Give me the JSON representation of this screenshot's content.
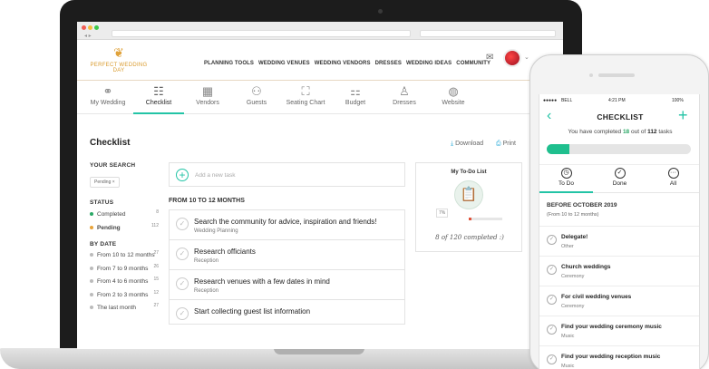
{
  "brand": {
    "name": "PERFECT WEDDING DAY",
    "color": "#d99a2b"
  },
  "accent": "#23c4a6",
  "header": {
    "nav": [
      "PLANNING TOOLS",
      "WEDDING VENUES",
      "WEDDING VENDORS",
      "DRESSES",
      "WEDDING IDEAS",
      "COMMUNITY"
    ]
  },
  "tabs": [
    {
      "label": "My Wedding",
      "icon": "rings-icon"
    },
    {
      "label": "Checklist",
      "icon": "clipboard-icon"
    },
    {
      "label": "Vendors",
      "icon": "store-icon"
    },
    {
      "label": "Guests",
      "icon": "people-icon"
    },
    {
      "label": "Seating Chart",
      "icon": "seating-icon"
    },
    {
      "label": "Budget",
      "icon": "budget-icon"
    },
    {
      "label": "Dresses",
      "icon": "dress-icon"
    },
    {
      "label": "Website",
      "icon": "globe-icon"
    }
  ],
  "page": {
    "title": "Checklist",
    "download": "Download",
    "print": "Print"
  },
  "sidebar": {
    "search_heading": "YOUR SEARCH",
    "search_chip": "Pending ×",
    "status_heading": "STATUS",
    "status": [
      {
        "label": "Completed",
        "count": "8",
        "color": "#2aa866"
      },
      {
        "label": "Pending",
        "count": "112",
        "color": "#e8a33a"
      }
    ],
    "date_heading": "BY DATE",
    "dates": [
      {
        "label": "From 10 to 12 months",
        "count": "27"
      },
      {
        "label": "From 7 to 9 months",
        "count": "26"
      },
      {
        "label": "From 4 to 6 months",
        "count": "15"
      },
      {
        "label": "From 2 to 3 months",
        "count": "12"
      },
      {
        "label": "The last month",
        "count": "27"
      }
    ]
  },
  "add_task_placeholder": "Add a new task",
  "section_title": "FROM 10 TO 12 MONTHS",
  "tasks": [
    {
      "title": "Search the community for advice, inspiration and friends!",
      "category": "Wedding Planning"
    },
    {
      "title": "Research officiants",
      "category": "Reception"
    },
    {
      "title": "Research venues with a few dates in mind",
      "category": "Reception"
    },
    {
      "title": "Start collecting guest list information",
      "category": ""
    }
  ],
  "todo_card": {
    "heading": "My To-Do List",
    "percent": "7%",
    "percent_value": 0.07,
    "completed_text": "8 of 120 completed :)"
  },
  "phone": {
    "carrier": "BELL",
    "time": "4:21 PM",
    "battery": "100%",
    "title": "CHECKLIST",
    "progress_prefix": "You have completed",
    "progress_done": "18",
    "progress_mid": "out of",
    "progress_total": "112",
    "progress_suffix": "tasks",
    "progress_value": 0.16,
    "tabs": [
      {
        "label": "To Do",
        "icon": "clock-icon"
      },
      {
        "label": "Done",
        "icon": "check-icon"
      },
      {
        "label": "All",
        "icon": "more-icon"
      }
    ],
    "group_heading": "BEFORE OCTOBER 2019",
    "group_sub": "(From 10 to 12 months)",
    "items": [
      {
        "title": "Delegate!",
        "category": "Other"
      },
      {
        "title": "Church weddings",
        "category": "Ceremony"
      },
      {
        "title": "For civil wedding venues",
        "category": "Ceremony"
      },
      {
        "title": "Find your wedding ceremony music",
        "category": "Music"
      },
      {
        "title": "Find your wedding reception music",
        "category": "Music"
      }
    ]
  }
}
